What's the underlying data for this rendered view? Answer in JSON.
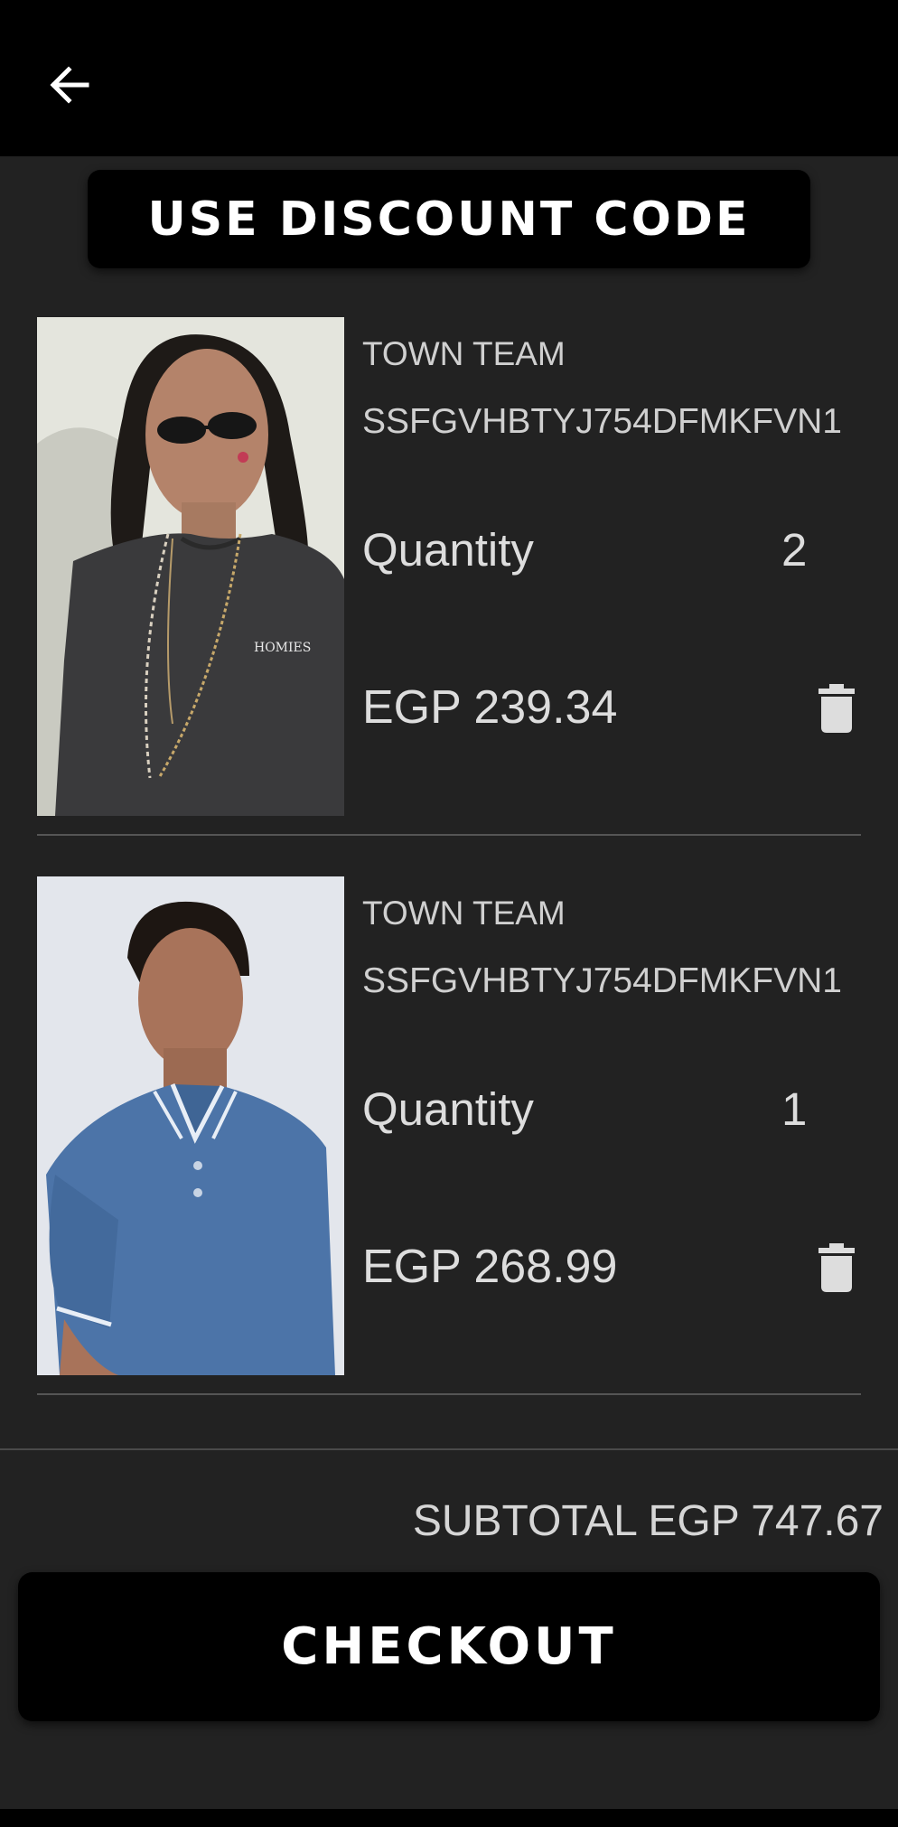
{
  "app_bar": {
    "back_icon": "arrow-left-icon"
  },
  "discount": {
    "label": "USE DISCOUNT CODE"
  },
  "cart": {
    "items": [
      {
        "brand": "TOWN TEAM",
        "sku": "SSFGVHBTYJ754DFMKFVN1",
        "quantity_label": "Quantity",
        "quantity": "2",
        "price": "EGP 239.34",
        "image": "woman-dark-tshirt-sunglasses-photo",
        "delete_icon": "trash-icon"
      },
      {
        "brand": "TOWN TEAM",
        "sku": "SSFGVHBTYJ754DFMKFVN1",
        "quantity_label": "Quantity",
        "quantity": "1",
        "price": "EGP 268.99",
        "image": "man-blue-polo-photo",
        "delete_icon": "trash-icon"
      }
    ]
  },
  "summary": {
    "subtotal": "SUBTOTAL EGP 747.67"
  },
  "checkout": {
    "label": "CHECKOUT"
  },
  "colors": {
    "background": "#222222",
    "bar": "#000000",
    "text": "#dddddd",
    "button_text": "#ffffff"
  }
}
